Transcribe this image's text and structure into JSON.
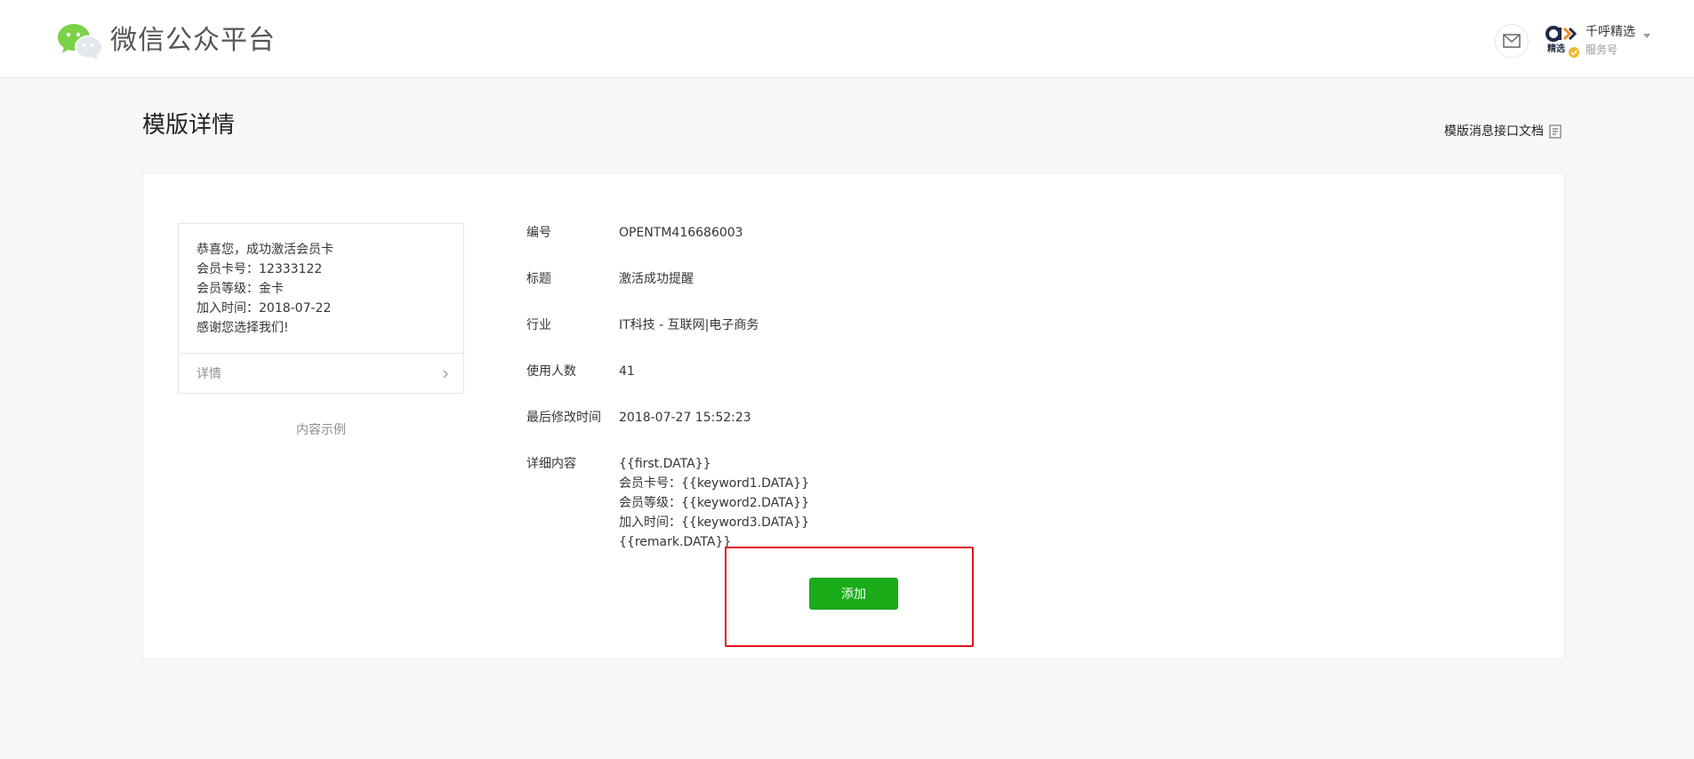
{
  "header": {
    "brand": "微信公众平台",
    "account": {
      "name": "千呼精选",
      "type": "服务号"
    }
  },
  "page": {
    "title": "模版详情",
    "doc_link": "模版消息接口文档"
  },
  "preview": {
    "lines": [
      "恭喜您，成功激活会员卡",
      "会员卡号：12333122",
      "会员等级：金卡",
      "加入时间：2018-07-22",
      "感谢您选择我们!"
    ],
    "footer_label": "详情",
    "caption": "内容示例"
  },
  "details": {
    "id": {
      "label": "编号",
      "value": "OPENTM416686003"
    },
    "title": {
      "label": "标题",
      "value": "激活成功提醒"
    },
    "industry": {
      "label": "行业",
      "value": "IT科技 - 互联网|电子商务"
    },
    "usage": {
      "label": "使用人数",
      "value": "41"
    },
    "modified": {
      "label": "最后修改时间",
      "value": "2018-07-27 15:52:23"
    },
    "content": {
      "label": "详细内容",
      "lines": [
        "{{first.DATA}}",
        "会员卡号：{{keyword1.DATA}}",
        "会员等级：{{keyword2.DATA}}",
        "加入时间：{{keyword3.DATA}}",
        "{{remark.DATA}}"
      ]
    }
  },
  "actions": {
    "add_label": "添加"
  },
  "colors": {
    "primary_green": "#1aad19",
    "highlight_red": "#e0141a"
  }
}
